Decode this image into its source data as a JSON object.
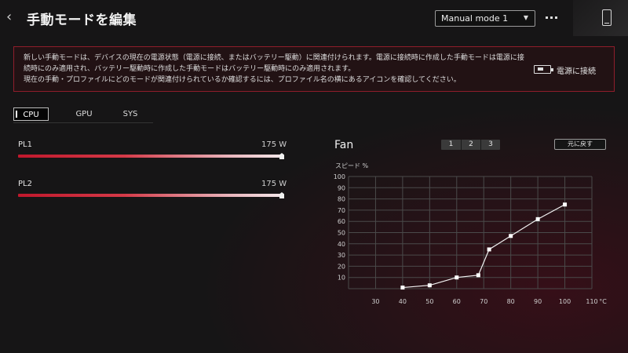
{
  "header": {
    "back_icon": "chevron-left-icon",
    "title": "手動モードを編集",
    "mode_select": {
      "selected": "Manual mode 1"
    },
    "more_icon": "more-dots-icon",
    "device_icon": "device-phone-icon"
  },
  "notice": {
    "lines": [
      "新しい手動モードは、デバイスの現在の電源状態（電源に接続、またはバッテリー駆動）に関連付けられます。電源に接続時に作成した手動モードは電源に接",
      "続時にのみ適用され、バッテリー駆動時に作成した手動モードはバッテリー駆動時にのみ適用されます。",
      "現在の手動・プロファイルにどのモードが関連付けられているか確認するには、プロファイル名の横にあるアイコンを確認してください。"
    ],
    "power_icon": "power-plug-icon",
    "power_status": "電源に接続"
  },
  "tabs": [
    {
      "label": "CPU",
      "active": true
    },
    {
      "label": "GPU",
      "active": false
    },
    {
      "label": "SYS",
      "active": false
    }
  ],
  "sliders": [
    {
      "label": "PL1",
      "value_text": "175 W",
      "level": 1.0
    },
    {
      "label": "PL2",
      "value_text": "175 W",
      "level": 1.0
    }
  ],
  "fan": {
    "title": "Fan",
    "curve_tabs": [
      "1",
      "2",
      "3"
    ],
    "reset_label": "元に戻す",
    "y_title": "スピード %"
  },
  "colors": {
    "accent": "#c0182c",
    "notice_border": "#8f1d2b",
    "background": "#161516"
  },
  "chart_data": {
    "type": "line",
    "title": "",
    "xlabel": "°C",
    "ylabel": "スピード %",
    "xlim": [
      20,
      110
    ],
    "ylim": [
      0,
      100
    ],
    "x_ticks": [
      30,
      40,
      50,
      60,
      70,
      80,
      90,
      100,
      110
    ],
    "y_ticks": [
      10,
      20,
      30,
      40,
      50,
      60,
      70,
      80,
      90,
      100
    ],
    "grid": true,
    "series": [
      {
        "x": [
          40,
          50,
          60,
          68,
          72,
          80,
          90,
          100
        ],
        "y": [
          1,
          3,
          10,
          12,
          35,
          47,
          62,
          75
        ]
      }
    ]
  }
}
